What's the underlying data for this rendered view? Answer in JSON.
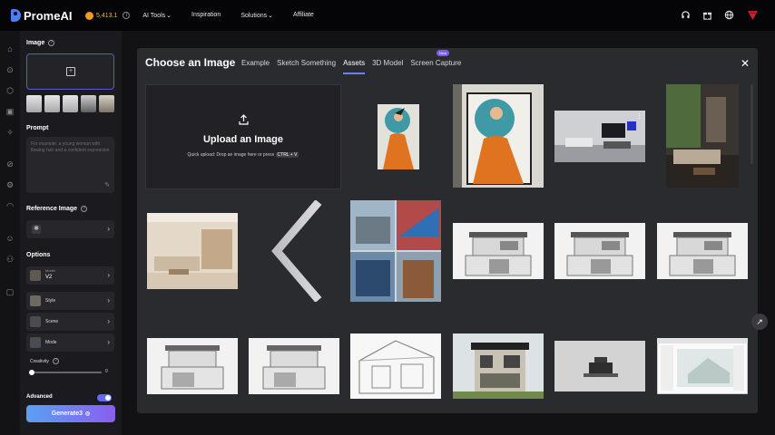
{
  "brand": {
    "name": "PromeAI"
  },
  "topbar": {
    "credits": "5,413.1",
    "nav": [
      "AI Tools",
      "Inspiration",
      "Solutions",
      "Affiliate"
    ],
    "icons": [
      "headset-icon",
      "gift-icon",
      "globe-icon",
      "avatar-icon"
    ]
  },
  "rail_icons": [
    "home-icon",
    "explore-icon",
    "box-icon",
    "layers-icon",
    "bulb-icon",
    "edit-icon",
    "settings-icon",
    "bell-icon",
    "user-icon",
    "team-icon",
    "bag-icon"
  ],
  "panel": {
    "image_title": "Image",
    "prompt_title": "Prompt",
    "prompt_placeholder": "For example: a young woman with flowing hair and a confident expression",
    "reference_title": "Reference Image",
    "options_title": "Options",
    "model_label": "Model",
    "model_value": "V2",
    "style_label": "Style",
    "scene_label": "Scene",
    "mode_label": "Mode",
    "creativity_label": "Creativity",
    "creativity_value": "0",
    "creativity_level": 0,
    "advanced_label": "Advanced",
    "generate_label": "Generate3"
  },
  "modal": {
    "title": "Choose an Image",
    "tabs": [
      "Example",
      "Sketch Something",
      "Assets",
      "3D Model",
      "Screen Capture"
    ],
    "active_tab": "Assets",
    "new_badge": "New",
    "upload_title": "Upload an Image",
    "upload_sub_prefix": "Quick upload: Drop an image here or press",
    "upload_shortcut": "CTRL + V"
  },
  "colors": {
    "accent": "#6f7cf5",
    "credits": "#f0b34a",
    "generate_start": "#5aa0f5",
    "generate_end": "#8a5ef0",
    "avatar": "#e0242b"
  }
}
